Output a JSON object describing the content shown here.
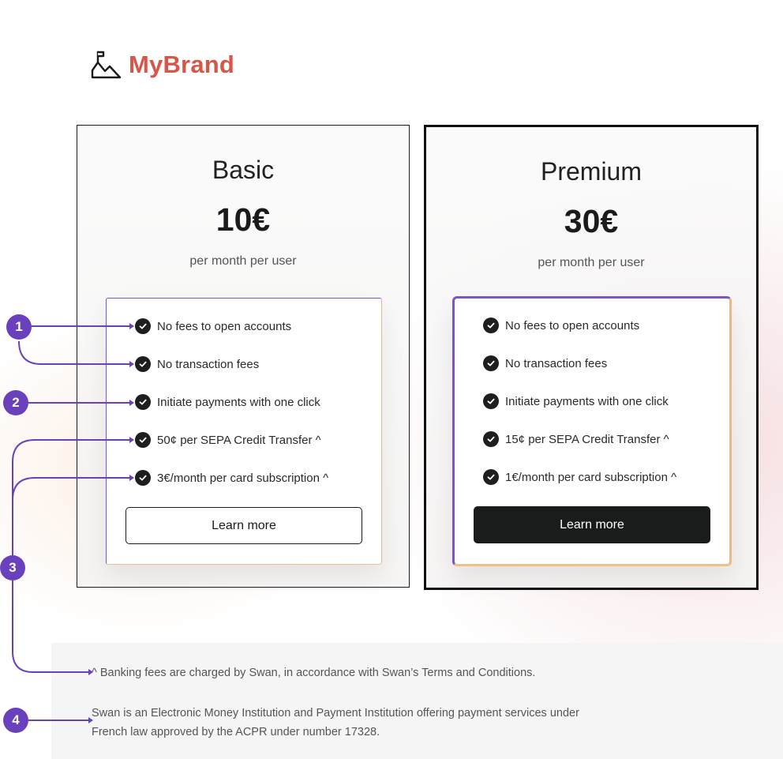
{
  "brand": {
    "name": "MyBrand",
    "color": "#d4574a"
  },
  "plans": [
    {
      "name": "Basic",
      "price": "10€",
      "period": "per month per user",
      "features": [
        "No fees to open accounts",
        "No transaction fees",
        "Initiate payments with one click",
        "50¢ per SEPA Credit Transfer ^",
        "3€/month per card subscription ^"
      ],
      "cta": "Learn more"
    },
    {
      "name": "Premium",
      "price": "30€",
      "period": "per month per user",
      "features": [
        "No fees to open accounts",
        "No transaction fees",
        "Initiate payments with one click",
        "15¢ per SEPA Credit Transfer ^",
        "1€/month per card subscription ^"
      ],
      "cta": "Learn more"
    }
  ],
  "footer": {
    "note": "^ Banking fees are charged by Swan, in accordance with Swan’s Terms and Conditions.",
    "legal_line1": "Swan is an Electronic Money Institution and Payment Institution offering payment services under",
    "legal_line2": "French law approved by the ACPR under number 17328."
  },
  "annotations": [
    "1",
    "2",
    "3",
    "4"
  ],
  "colors": {
    "annotation": "#6a41bd",
    "accent_border": "#7b56c8",
    "warm_border": "#e9b98a",
    "button_dark": "#1a1c1c"
  }
}
